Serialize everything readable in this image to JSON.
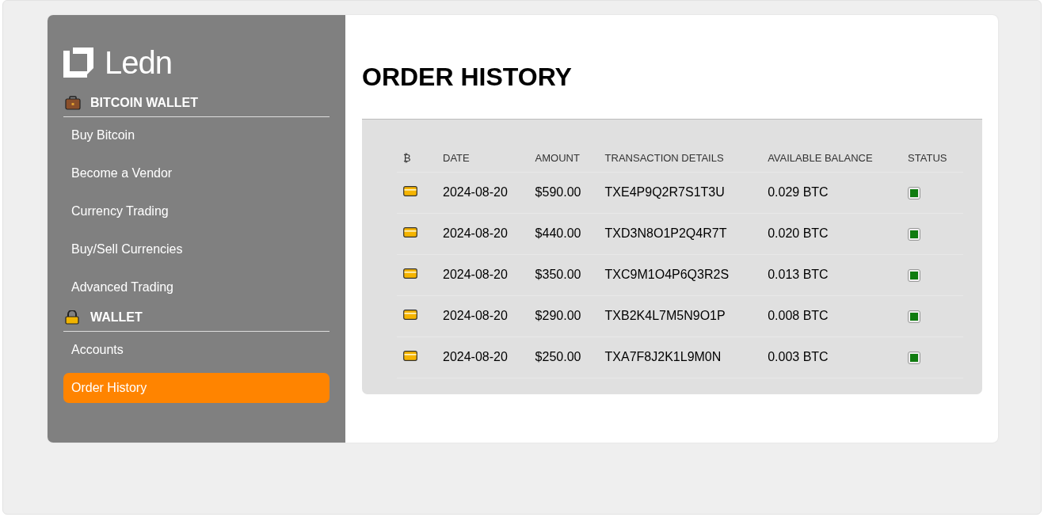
{
  "logo": {
    "text": "Ledn"
  },
  "sidebar": {
    "sections": [
      {
        "title": "BITCOIN WALLET",
        "kind": "briefcase",
        "items": [
          {
            "label": "Buy Bitcoin",
            "selected": false
          },
          {
            "label": "Become a Vendor",
            "selected": false
          },
          {
            "label": "Currency Trading",
            "selected": false
          },
          {
            "label": "Buy/Sell Currencies",
            "selected": false
          },
          {
            "label": "Advanced Trading",
            "selected": false
          }
        ]
      },
      {
        "title": "WALLET",
        "kind": "lock",
        "items": [
          {
            "label": "Accounts",
            "selected": false
          },
          {
            "label": "Order History",
            "selected": true
          }
        ]
      }
    ]
  },
  "page": {
    "title": "ORDER HISTORY"
  },
  "table": {
    "columns": [
      "₿",
      "DATE",
      "AMOUNT",
      "TRANSACTION DETAILS",
      "AVAILABLE BALANCE",
      "STATUS"
    ],
    "rows": [
      {
        "date": "2024-08-20",
        "amount": "$590.00",
        "details": "TXE4P9Q2R7S1T3U",
        "balance": "0.029 BTC",
        "color": "#107c10"
      },
      {
        "date": "2024-08-20",
        "amount": "$440.00",
        "details": "TXD3N8O1P2Q4R7T",
        "balance": "0.020 BTC",
        "color": "#107c10"
      },
      {
        "date": "2024-08-20",
        "amount": "$350.00",
        "details": "TXC9M1O4P6Q3R2S",
        "balance": "0.013 BTC",
        "color": "#107c10"
      },
      {
        "date": "2024-08-20",
        "amount": "$290.00",
        "details": "TXB2K4L7M5N9O1P",
        "balance": "0.008 BTC",
        "color": "#107c10"
      },
      {
        "date": "2024-08-20",
        "amount": "$250.00",
        "details": "TXA7F8J2K1L9M0N",
        "balance": "0.003 BTC",
        "color": "#107c10"
      }
    ]
  }
}
